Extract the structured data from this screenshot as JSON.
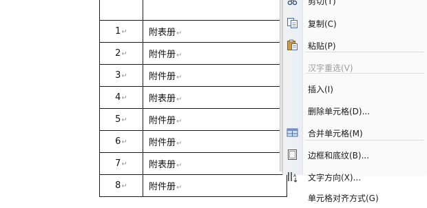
{
  "table": {
    "rows": [
      {
        "num": "",
        "name": ""
      },
      {
        "num": "1",
        "name": "附表册"
      },
      {
        "num": "2",
        "name": "附件册"
      },
      {
        "num": "3",
        "name": "附件册"
      },
      {
        "num": "4",
        "name": "附表册"
      },
      {
        "num": "5",
        "name": "附件册"
      },
      {
        "num": "6",
        "name": "附件册"
      },
      {
        "num": "7",
        "name": "附表册"
      },
      {
        "num": "8",
        "name": "附件册"
      }
    ],
    "mark": "↵"
  },
  "context_menu": {
    "items": [
      {
        "label": "剪切(T)",
        "icon": "scissors-icon",
        "enabled": true
      },
      {
        "label": "复制(C)",
        "icon": "copy-icon",
        "enabled": true
      },
      {
        "label": "粘贴(P)",
        "icon": "paste-icon",
        "enabled": true
      },
      {
        "label": "汉字重选(V)",
        "icon": "",
        "enabled": false
      },
      {
        "label": "插入(I)",
        "icon": "",
        "enabled": true
      },
      {
        "label": "删除单元格(D)...",
        "icon": "",
        "enabled": true
      },
      {
        "label": "合并单元格(M)",
        "icon": "merge-cells-icon",
        "enabled": true
      },
      {
        "label": "边框和底纹(B)...",
        "icon": "borders-icon",
        "enabled": true
      },
      {
        "label": "文字方向(X)...",
        "icon": "text-direction-icon",
        "enabled": true
      },
      {
        "label": "单元格对齐方式(G)",
        "icon": "",
        "enabled": true
      }
    ]
  }
}
